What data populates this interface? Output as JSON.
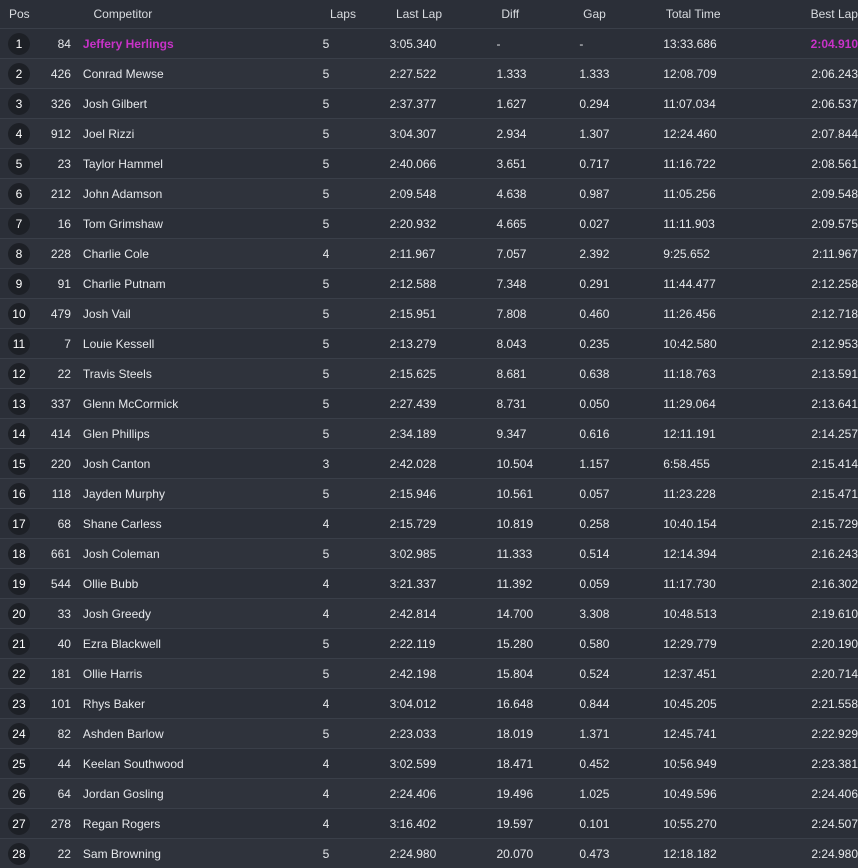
{
  "headers": {
    "pos": "Pos",
    "competitor": "Competitor",
    "laps": "Laps",
    "last_lap": "Last Lap",
    "diff": "Diff",
    "gap": "Gap",
    "total_time": "Total Time",
    "best_lap": "Best Lap"
  },
  "colors": {
    "background": "#2b2f38",
    "row_alt": "#2f333c",
    "leader_highlight": "#c832c8",
    "badge": "#1d2026"
  },
  "rows": [
    {
      "pos": "1",
      "num": "84",
      "name": "Jeffery Herlings",
      "laps": "5",
      "last": "3:05.340",
      "diff": "-",
      "gap": "-",
      "total": "13:33.686",
      "best": "2:04.910",
      "highlight": true
    },
    {
      "pos": "2",
      "num": "426",
      "name": "Conrad Mewse",
      "laps": "5",
      "last": "2:27.522",
      "diff": "1.333",
      "gap": "1.333",
      "total": "12:08.709",
      "best": "2:06.243"
    },
    {
      "pos": "3",
      "num": "326",
      "name": "Josh Gilbert",
      "laps": "5",
      "last": "2:37.377",
      "diff": "1.627",
      "gap": "0.294",
      "total": "11:07.034",
      "best": "2:06.537"
    },
    {
      "pos": "4",
      "num": "912",
      "name": "Joel Rizzi",
      "laps": "5",
      "last": "3:04.307",
      "diff": "2.934",
      "gap": "1.307",
      "total": "12:24.460",
      "best": "2:07.844"
    },
    {
      "pos": "5",
      "num": "23",
      "name": "Taylor Hammel",
      "laps": "5",
      "last": "2:40.066",
      "diff": "3.651",
      "gap": "0.717",
      "total": "11:16.722",
      "best": "2:08.561"
    },
    {
      "pos": "6",
      "num": "212",
      "name": "John Adamson",
      "laps": "5",
      "last": "2:09.548",
      "diff": "4.638",
      "gap": "0.987",
      "total": "11:05.256",
      "best": "2:09.548"
    },
    {
      "pos": "7",
      "num": "16",
      "name": "Tom Grimshaw",
      "laps": "5",
      "last": "2:20.932",
      "diff": "4.665",
      "gap": "0.027",
      "total": "11:11.903",
      "best": "2:09.575"
    },
    {
      "pos": "8",
      "num": "228",
      "name": "Charlie Cole",
      "laps": "4",
      "last": "2:11.967",
      "diff": "7.057",
      "gap": "2.392",
      "total": "9:25.652",
      "best": "2:11.967"
    },
    {
      "pos": "9",
      "num": "91",
      "name": "Charlie Putnam",
      "laps": "5",
      "last": "2:12.588",
      "diff": "7.348",
      "gap": "0.291",
      "total": "11:44.477",
      "best": "2:12.258"
    },
    {
      "pos": "10",
      "num": "479",
      "name": "Josh Vail",
      "laps": "5",
      "last": "2:15.951",
      "diff": "7.808",
      "gap": "0.460",
      "total": "11:26.456",
      "best": "2:12.718"
    },
    {
      "pos": "11",
      "num": "7",
      "name": "Louie Kessell",
      "laps": "5",
      "last": "2:13.279",
      "diff": "8.043",
      "gap": "0.235",
      "total": "10:42.580",
      "best": "2:12.953"
    },
    {
      "pos": "12",
      "num": "22",
      "name": "Travis Steels",
      "laps": "5",
      "last": "2:15.625",
      "diff": "8.681",
      "gap": "0.638",
      "total": "11:18.763",
      "best": "2:13.591"
    },
    {
      "pos": "13",
      "num": "337",
      "name": "Glenn McCormick",
      "laps": "5",
      "last": "2:27.439",
      "diff": "8.731",
      "gap": "0.050",
      "total": "11:29.064",
      "best": "2:13.641"
    },
    {
      "pos": "14",
      "num": "414",
      "name": "Glen Phillips",
      "laps": "5",
      "last": "2:34.189",
      "diff": "9.347",
      "gap": "0.616",
      "total": "12:11.191",
      "best": "2:14.257"
    },
    {
      "pos": "15",
      "num": "220",
      "name": "Josh Canton",
      "laps": "3",
      "last": "2:42.028",
      "diff": "10.504",
      "gap": "1.157",
      "total": "6:58.455",
      "best": "2:15.414"
    },
    {
      "pos": "16",
      "num": "118",
      "name": "Jayden Murphy",
      "laps": "5",
      "last": "2:15.946",
      "diff": "10.561",
      "gap": "0.057",
      "total": "11:23.228",
      "best": "2:15.471"
    },
    {
      "pos": "17",
      "num": "68",
      "name": "Shane Carless",
      "laps": "4",
      "last": "2:15.729",
      "diff": "10.819",
      "gap": "0.258",
      "total": "10:40.154",
      "best": "2:15.729"
    },
    {
      "pos": "18",
      "num": "661",
      "name": "Josh Coleman",
      "laps": "5",
      "last": "3:02.985",
      "diff": "11.333",
      "gap": "0.514",
      "total": "12:14.394",
      "best": "2:16.243"
    },
    {
      "pos": "19",
      "num": "544",
      "name": "Ollie Bubb",
      "laps": "4",
      "last": "3:21.337",
      "diff": "11.392",
      "gap": "0.059",
      "total": "11:17.730",
      "best": "2:16.302"
    },
    {
      "pos": "20",
      "num": "33",
      "name": "Josh Greedy",
      "laps": "4",
      "last": "2:42.814",
      "diff": "14.700",
      "gap": "3.308",
      "total": "10:48.513",
      "best": "2:19.610"
    },
    {
      "pos": "21",
      "num": "40",
      "name": "Ezra Blackwell",
      "laps": "5",
      "last": "2:22.119",
      "diff": "15.280",
      "gap": "0.580",
      "total": "12:29.779",
      "best": "2:20.190"
    },
    {
      "pos": "22",
      "num": "181",
      "name": "Ollie Harris",
      "laps": "5",
      "last": "2:42.198",
      "diff": "15.804",
      "gap": "0.524",
      "total": "12:37.451",
      "best": "2:20.714"
    },
    {
      "pos": "23",
      "num": "101",
      "name": "Rhys Baker",
      "laps": "4",
      "last": "3:04.012",
      "diff": "16.648",
      "gap": "0.844",
      "total": "10:45.205",
      "best": "2:21.558"
    },
    {
      "pos": "24",
      "num": "82",
      "name": "Ashden Barlow",
      "laps": "5",
      "last": "2:23.033",
      "diff": "18.019",
      "gap": "1.371",
      "total": "12:45.741",
      "best": "2:22.929"
    },
    {
      "pos": "25",
      "num": "44",
      "name": "Keelan Southwood",
      "laps": "4",
      "last": "3:02.599",
      "diff": "18.471",
      "gap": "0.452",
      "total": "10:56.949",
      "best": "2:23.381"
    },
    {
      "pos": "26",
      "num": "64",
      "name": "Jordan Gosling",
      "laps": "4",
      "last": "2:24.406",
      "diff": "19.496",
      "gap": "1.025",
      "total": "10:49.596",
      "best": "2:24.406"
    },
    {
      "pos": "27",
      "num": "278",
      "name": "Regan Rogers",
      "laps": "4",
      "last": "3:16.402",
      "diff": "19.597",
      "gap": "0.101",
      "total": "10:55.270",
      "best": "2:24.507"
    },
    {
      "pos": "28",
      "num": "22",
      "name": "Sam Browning",
      "laps": "5",
      "last": "2:24.980",
      "diff": "20.070",
      "gap": "0.473",
      "total": "12:18.182",
      "best": "2:24.980"
    }
  ]
}
